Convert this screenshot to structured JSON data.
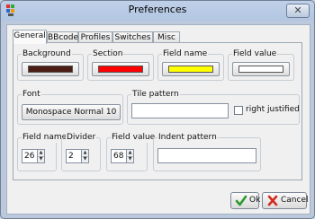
{
  "window": {
    "title": "Preferences",
    "close_glyph": "✕"
  },
  "tabs": [
    "General",
    "BBcode",
    "Profiles",
    "Switches",
    "Misc"
  ],
  "colors": {
    "background": {
      "label": "Background",
      "value": "#4a1c14"
    },
    "section": {
      "label": "Section",
      "value": "#ff0000"
    },
    "field_name": {
      "label": "Field name",
      "value": "#ffff00"
    },
    "field_value": {
      "label": "Field value",
      "value": "#ffffff"
    }
  },
  "font": {
    "label": "Font",
    "button": "Monospace Normal  10"
  },
  "tile_pattern": {
    "label": "Tile pattern",
    "value": "",
    "right_justified_label": "right justified",
    "right_justified_checked": false
  },
  "numbers": {
    "field_name": {
      "label": "Field name",
      "value": "26"
    },
    "divider": {
      "label": "Divider",
      "value": "2"
    },
    "field_value": {
      "label": "Field value",
      "value": "68"
    },
    "indent_pattern": {
      "label": "Indent pattern",
      "value": ""
    }
  },
  "buttons": {
    "ok": "Ok",
    "cancel": "Cancel"
  },
  "icons": {
    "app": "app-icon",
    "ok": "check-icon",
    "cancel": "cross-icon"
  }
}
